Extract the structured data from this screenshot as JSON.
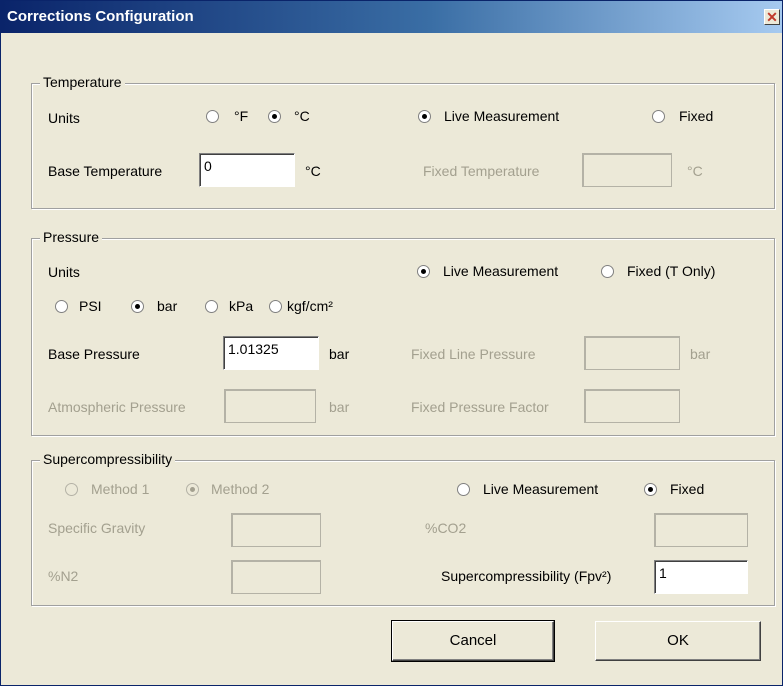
{
  "window": {
    "title": "Corrections Configuration",
    "close_glyph": "✕"
  },
  "temperature": {
    "group_label": "Temperature",
    "units_label": "Units",
    "unit_f": "°F",
    "unit_c": "°C",
    "selected_unit": "°C",
    "live_label": "Live Measurement",
    "fixed_label": "Fixed",
    "selected_mode": "Live Measurement",
    "base_label": "Base Temperature",
    "base_value": "0",
    "base_unit": "°C",
    "fixed_temp_label": "Fixed Temperature",
    "fixed_temp_value": "",
    "fixed_temp_unit": "°C"
  },
  "pressure": {
    "group_label": "Pressure",
    "units_label": "Units",
    "unit_psi": "PSI",
    "unit_bar": "bar",
    "unit_kpa": "kPa",
    "unit_kgf": "kgf/cm²",
    "selected_unit": "bar",
    "live_label": "Live Measurement",
    "fixed_label": "Fixed (T Only)",
    "selected_mode": "Live Measurement",
    "base_label": "Base Pressure",
    "base_value": "1.01325",
    "base_unit": "bar",
    "fixed_line_label": "Fixed Line Pressure",
    "fixed_line_value": "",
    "fixed_line_unit": "bar",
    "atm_label": "Atmospheric Pressure",
    "atm_value": "",
    "atm_unit": "bar",
    "fixed_factor_label": "Fixed Pressure Factor",
    "fixed_factor_value": ""
  },
  "supercompressibility": {
    "group_label": "Supercompressibility",
    "method1_label": "Method 1",
    "method2_label": "Method 2",
    "selected_method": "Method 2",
    "live_label": "Live Measurement",
    "fixed_label": "Fixed",
    "selected_mode": "Fixed",
    "sg_label": "Specific Gravity",
    "sg_value": "",
    "co2_label": "%CO2",
    "co2_value": "",
    "n2_label": "%N2",
    "n2_value": "",
    "fpv_label": "Supercompressibility (Fpv²)",
    "fpv_value": "1"
  },
  "buttons": {
    "cancel": "Cancel",
    "ok": "OK"
  },
  "colors": {
    "titlebar_start": "#0a246a",
    "titlebar_end": "#a6caf0",
    "dialog_bg": "#ece9d8",
    "disabled_text": "#a3a08f"
  }
}
